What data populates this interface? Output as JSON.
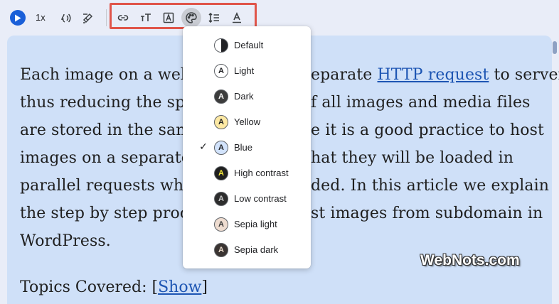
{
  "toolbar": {
    "speed_label": "1x",
    "icons": [
      "play-icon",
      "voice-icon",
      "highlighter-icon",
      "link-icon",
      "font-size-icon",
      "font-icon",
      "palette-icon",
      "line-spacing-icon",
      "text-color-icon"
    ]
  },
  "article": {
    "lines": [
      {
        "before": "Each image on a web",
        "link": "",
        "after": ""
      },
      {
        "before": "thus reducing the spe",
        "link": "",
        "after": ""
      },
      {
        "before": "are stored in the sam",
        "link": "",
        "after": ""
      },
      {
        "before": "images on a separate",
        "link": "",
        "after": ""
      },
      {
        "before": "parallel requests whe",
        "link": "",
        "after": ""
      },
      {
        "before": "the step by step proce",
        "link": "",
        "after": ""
      },
      {
        "before": "WordPress.",
        "link": "",
        "after": ""
      }
    ],
    "right_fragments": [
      {
        "before": "eparate ",
        "link": "HTTP request",
        "after": " to server"
      },
      {
        "before": "f all images and media files",
        "link": "",
        "after": ""
      },
      {
        "before": "e it is a good practice to host",
        "link": "",
        "after": ""
      },
      {
        "before": "hat they will be loaded in",
        "link": "",
        "after": ""
      },
      {
        "before": "ded. In this article we explain",
        "link": "",
        "after": ""
      },
      {
        "before": "st images from subdomain in",
        "link": "",
        "after": ""
      }
    ],
    "topics_label": "Topics Covered: [",
    "topics_link": "Show",
    "topics_end": "]"
  },
  "color_menu": {
    "selected": "Blue",
    "items": [
      {
        "label": "Default",
        "swatch_bg": "half",
        "swatch_fg": "#202124",
        "letter": ""
      },
      {
        "label": "Light",
        "swatch_bg": "#ffffff",
        "swatch_fg": "#202124",
        "letter": "A"
      },
      {
        "label": "Dark",
        "swatch_bg": "#3c3c3c",
        "swatch_fg": "#ffffff",
        "letter": "A"
      },
      {
        "label": "Yellow",
        "swatch_bg": "#fde9a4",
        "swatch_fg": "#202124",
        "letter": "A"
      },
      {
        "label": "Blue",
        "swatch_bg": "#d2e3fc",
        "swatch_fg": "#202124",
        "letter": "A"
      },
      {
        "label": "High contrast",
        "swatch_bg": "#1f1f1f",
        "swatch_fg": "#f5e83a",
        "letter": "A"
      },
      {
        "label": "Low contrast",
        "swatch_bg": "#2d2d2d",
        "swatch_fg": "#c8c8c8",
        "letter": "A"
      },
      {
        "label": "Sepia light",
        "swatch_bg": "#eedcd0",
        "swatch_fg": "#3c3c3c",
        "letter": "A"
      },
      {
        "label": "Sepia dark",
        "swatch_bg": "#3a3432",
        "swatch_fg": "#e7d8c9",
        "letter": "A"
      }
    ]
  },
  "watermark": "WebNots.com",
  "colors": {
    "accent": "#1a5fd8",
    "highlight_box": "#e0554a",
    "content_bg": "#cfe0f8",
    "link": "#1d55b3"
  }
}
